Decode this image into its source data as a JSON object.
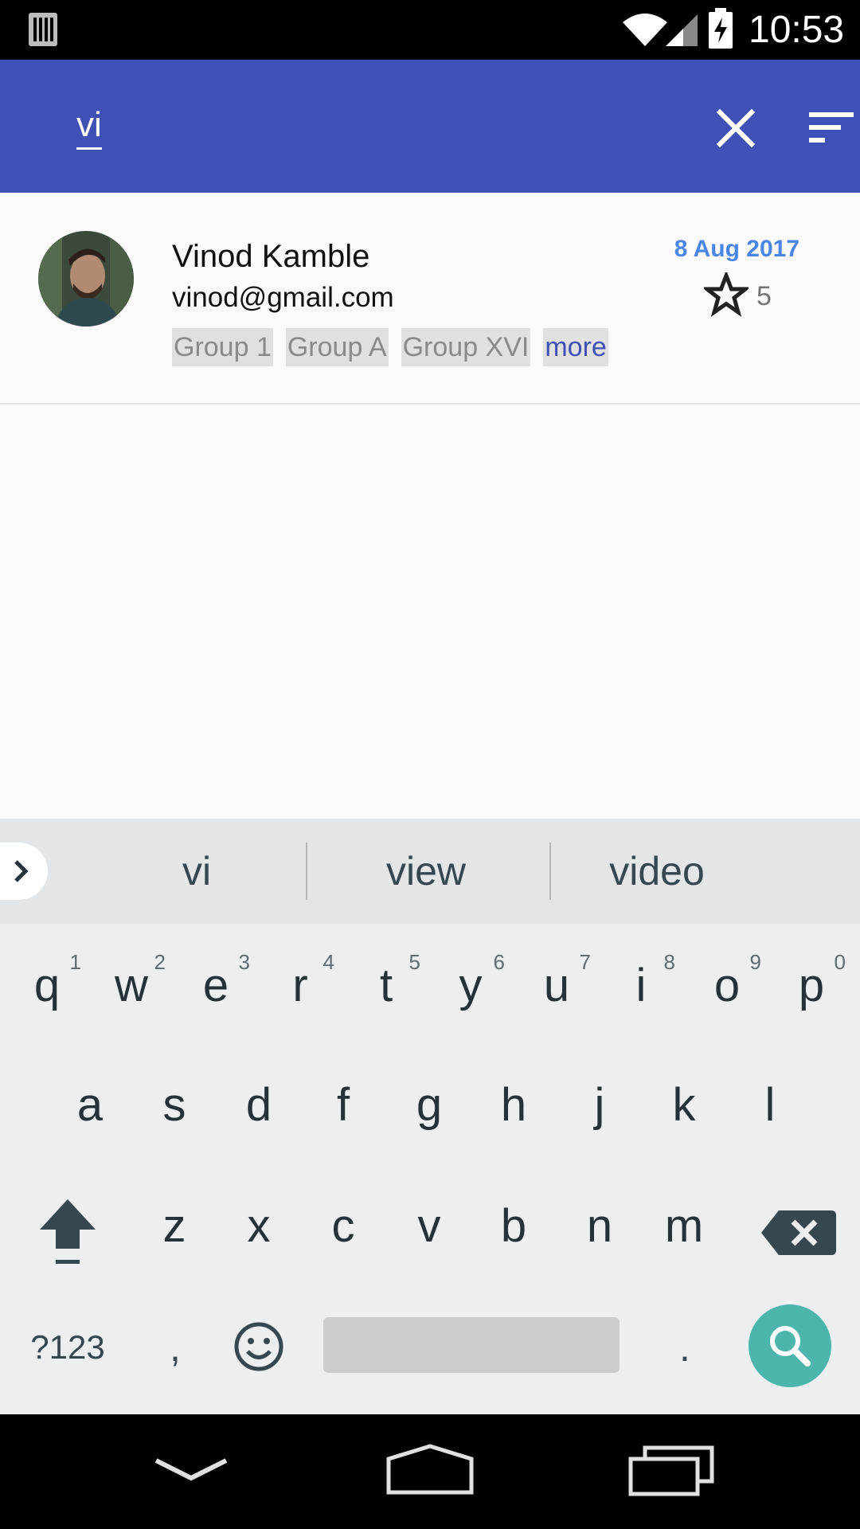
{
  "status_bar": {
    "time": "10:53"
  },
  "app_bar": {
    "search_query": "vi",
    "close_icon": "close-icon",
    "filter_icon": "filter-icon",
    "color": "#3F51B5"
  },
  "results": [
    {
      "name": "Vinod Kamble",
      "email": "vinod@gmail.com",
      "groups": [
        "Group 1",
        "Group A",
        "Group XVI"
      ],
      "more_label": "more",
      "date": "8 Aug 2017",
      "rating": "5",
      "star_icon": "star-outline-icon"
    }
  ],
  "keyboard": {
    "suggestions": [
      "vi",
      "view",
      "video"
    ],
    "row1": [
      {
        "key": "q",
        "hint": "1"
      },
      {
        "key": "w",
        "hint": "2"
      },
      {
        "key": "e",
        "hint": "3"
      },
      {
        "key": "r",
        "hint": "4"
      },
      {
        "key": "t",
        "hint": "5"
      },
      {
        "key": "y",
        "hint": "6"
      },
      {
        "key": "u",
        "hint": "7"
      },
      {
        "key": "i",
        "hint": "8"
      },
      {
        "key": "o",
        "hint": "9"
      },
      {
        "key": "p",
        "hint": "0"
      }
    ],
    "row2": [
      "a",
      "s",
      "d",
      "f",
      "g",
      "h",
      "j",
      "k",
      "l"
    ],
    "row3": [
      "z",
      "x",
      "c",
      "v",
      "b",
      "n",
      "m"
    ],
    "symbols_label": "?123",
    "comma_label": ",",
    "period_label": ".",
    "search_key_color": "#4DB6AC"
  }
}
